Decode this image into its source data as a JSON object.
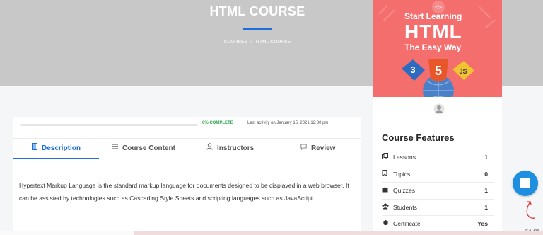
{
  "hero": {
    "title": "HTML COURSE",
    "breadcrumb": {
      "courses": "COURSES",
      "separator": "»",
      "current": "HTML COURSE"
    }
  },
  "progress": {
    "percent": 0,
    "label": "0% COMPLETE",
    "activity": "Last activity on January 15, 2021 12:30 pm"
  },
  "tabs": [
    {
      "label": "Description",
      "icon": "document-icon",
      "active": true
    },
    {
      "label": "Course Content",
      "icon": "list-icon",
      "active": false
    },
    {
      "label": "Instructors",
      "icon": "user-icon",
      "active": false
    },
    {
      "label": "Review",
      "icon": "comment-icon",
      "active": false
    }
  ],
  "description": "Hypertext Markup Language is the standard markup language for documents designed to be displayed in a web browser. It can be assisted by technologies such as Cascading Style Sheets and scripting languages such as JavaScript",
  "banner": {
    "line1": "Start Learning",
    "line2": "HTML",
    "line3": "The Easy Way",
    "tag": "</>",
    "html5_badge": "5",
    "css_badge": "3",
    "js_badge": "JS"
  },
  "features": {
    "title": "Course Features",
    "items": [
      {
        "label": "Lessons",
        "value": "1",
        "icon": "copy-icon"
      },
      {
        "label": "Topics",
        "value": "0",
        "icon": "bookmark-icon"
      },
      {
        "label": "Quizzes",
        "value": "1",
        "icon": "puzzle-icon"
      },
      {
        "label": "Students",
        "value": "1",
        "icon": "users-icon"
      },
      {
        "label": "Certificate",
        "value": "Yes",
        "icon": "graduation-cap-icon"
      }
    ]
  },
  "taskbar": {
    "clock": "6:20 PM"
  },
  "colors": {
    "accent": "#1e6fd9",
    "success": "#2ea44f",
    "banner": "#f46e6e",
    "hero": "#c8c8c8"
  }
}
